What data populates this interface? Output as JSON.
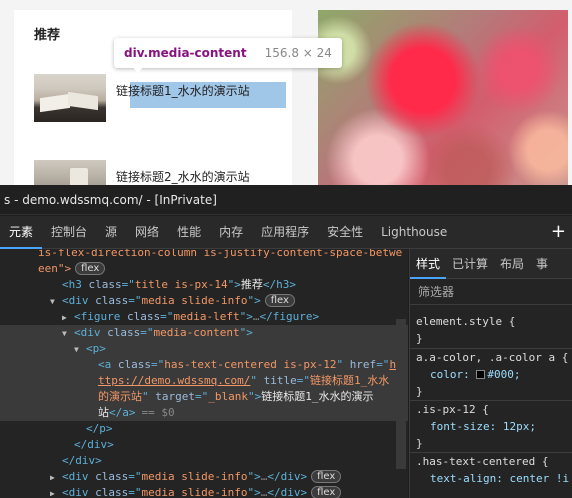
{
  "page": {
    "section_title": "推荐",
    "links": [
      "链接标题1_水水的演示站",
      "链接标题2_水水的演示站"
    ]
  },
  "tooltip": {
    "selector": "div.media-content",
    "size": "156.8 × 24"
  },
  "devtools": {
    "window_title": "s - demo.wdssmq.com/ - [InPrivate]",
    "tabs": [
      "元素",
      "控制台",
      "源",
      "网络",
      "性能",
      "内存",
      "应用程序",
      "安全性",
      "Lighthouse"
    ],
    "add_tab_label": "+",
    "elements": {
      "row0": "is-flex-direction-column is-justify-content-space-betwe",
      "row1_prefix": "een\">",
      "badge": "flex",
      "h3_class": "title is-px-14",
      "h3_text": "推荐",
      "div1_class": "media slide-info",
      "figure_class": "media-left",
      "ellipsis": "…",
      "div2_class": "media-content",
      "a_class": "has-text-centered is-px-12",
      "a_href_start": "h",
      "a_href_rest": "ttps://demo.wdssmq.com/",
      "a_title_start": "链接标题1_水水",
      "a_title_rest": "的演示站",
      "a_target": "_blank",
      "a_text_start": "链接标题1_水水的演示",
      "a_text_rest": "站",
      "eq_ref": "== $0",
      "div3_class": "media slide-info",
      "div4_class": "media slide-info"
    },
    "styles": {
      "tabs": [
        "样式",
        "已计算",
        "布局",
        "事"
      ],
      "filter_label": "筛选器",
      "rules": {
        "element_style": "element.style {",
        "a_color_selector": "a.a-color, .a-color a {",
        "a_color_prop": "color",
        "a_color_value": "#000;",
        "px12_selector": ".is-px-12 {",
        "px12_prop": "font-size",
        "px12_value": "12px;",
        "centered_selector": ".has-text-centered {",
        "centered_prop": "text-align",
        "centered_value": "center !i",
        "close_brace": "}"
      }
    }
  },
  "colors": {
    "highlight": "#6fa8dc",
    "tab_indicator": "#4aa3ff",
    "tag_blue": "#5db0d7",
    "attr_value": "#f29766",
    "tooltip_tag": "#881280"
  }
}
